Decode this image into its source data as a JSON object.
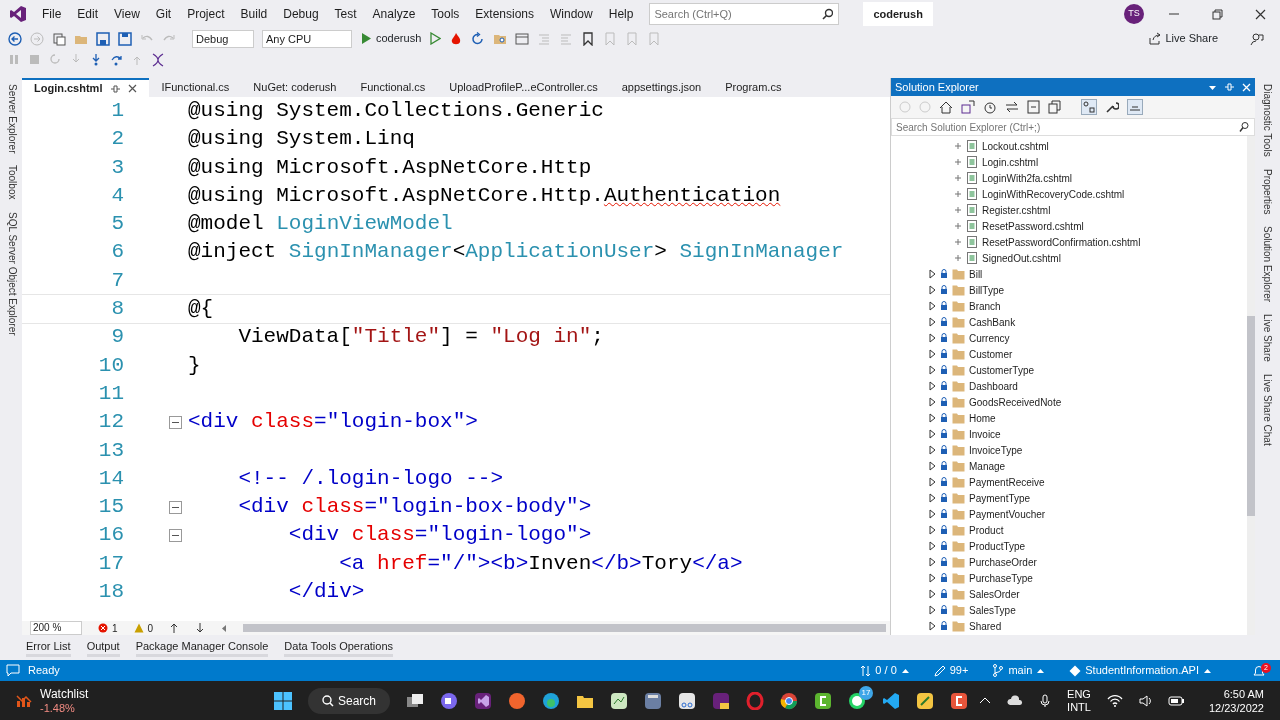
{
  "menu": [
    "File",
    "Edit",
    "View",
    "Git",
    "Project",
    "Build",
    "Debug",
    "Test",
    "Analyze",
    "Tools",
    "Extensions",
    "Window",
    "Help"
  ],
  "search": {
    "placeholder": "Search (Ctrl+Q)"
  },
  "solution_name": "coderush",
  "account_initials": "TS",
  "toolbar": {
    "configuration": "Debug",
    "platform": "Any CPU",
    "start_target": "coderush"
  },
  "live_share": "Live Share",
  "side_tabs_left": [
    "Server Explorer",
    "Toolbox",
    "SQL Server Object Explorer"
  ],
  "doc_tabs": [
    {
      "label": "Login.cshtml",
      "selected": true
    },
    {
      "label": "IFunctional.cs",
      "selected": false
    },
    {
      "label": "NuGet: coderush",
      "selected": false
    },
    {
      "label": "Functional.cs",
      "selected": false
    },
    {
      "label": "UploadProfileP...eController.cs",
      "selected": false
    },
    {
      "label": "appsettings.json",
      "selected": false
    },
    {
      "label": "Program.cs",
      "selected": false
    }
  ],
  "editor": {
    "lines": [
      {
        "number": "1",
        "current": false,
        "fold": false,
        "tokens": [
          {
            "text": "@using System.Collections.Generic",
            "color": "#000000",
            "error": false
          }
        ]
      },
      {
        "number": "2",
        "current": false,
        "fold": false,
        "tokens": [
          {
            "text": "@using System.Linq",
            "color": "#000000",
            "error": false
          }
        ]
      },
      {
        "number": "3",
        "current": false,
        "fold": false,
        "tokens": [
          {
            "text": "@using Microsoft.AspNetCore.Http",
            "color": "#000000",
            "error": false
          }
        ]
      },
      {
        "number": "4",
        "current": false,
        "fold": false,
        "tokens": [
          {
            "text": "@using Microsoft.AspNetCore.Http.",
            "color": "#000000",
            "error": false
          },
          {
            "text": "Authentication",
            "color": "#000000",
            "error": true
          }
        ]
      },
      {
        "number": "5",
        "current": false,
        "fold": false,
        "tokens": [
          {
            "text": "@model ",
            "color": "#000000",
            "error": false
          },
          {
            "text": "LoginViewModel",
            "color": "#2b91af",
            "error": false
          }
        ]
      },
      {
        "number": "6",
        "current": false,
        "fold": false,
        "tokens": [
          {
            "text": "@inject ",
            "color": "#000000",
            "error": false
          },
          {
            "text": "SignInManager",
            "color": "#2b91af",
            "error": false
          },
          {
            "text": "<",
            "color": "#000000",
            "error": false
          },
          {
            "text": "ApplicationUser",
            "color": "#2b91af",
            "error": false
          },
          {
            "text": "> ",
            "color": "#000000",
            "error": false
          },
          {
            "text": "SignInManager",
            "color": "#2b91af",
            "error": false
          }
        ]
      },
      {
        "number": "7",
        "current": false,
        "fold": false
      },
      {
        "number": "8",
        "current": true,
        "fold": false,
        "tokens": [
          {
            "text": "@{",
            "color": "#000000",
            "error": false
          }
        ]
      },
      {
        "number": "9",
        "current": false,
        "fold": false,
        "tokens": [
          {
            "text": "    ViewData[",
            "color": "#000000",
            "error": false
          },
          {
            "text": "\"Title\"",
            "color": "#a31515",
            "error": false
          },
          {
            "text": "] = ",
            "color": "#000000",
            "error": false
          },
          {
            "text": "\"Log in\"",
            "color": "#a31515",
            "error": false
          },
          {
            "text": ";",
            "color": "#000000",
            "error": false
          }
        ]
      },
      {
        "number": "10",
        "current": false,
        "fold": false,
        "tokens": [
          {
            "text": "}",
            "color": "#000000",
            "error": false
          }
        ]
      },
      {
        "number": "11",
        "current": false,
        "fold": false
      },
      {
        "number": "12",
        "current": false,
        "fold": true,
        "tokens": [
          {
            "text": "<div ",
            "color": "#0000c8",
            "error": false
          },
          {
            "text": "class",
            "color": "#e50000",
            "error": false
          },
          {
            "text": "=\"login-box\">",
            "color": "#0000c8",
            "error": false
          }
        ]
      },
      {
        "number": "13",
        "current": false,
        "fold": false
      },
      {
        "number": "14",
        "current": false,
        "fold": false,
        "tokens": [
          {
            "text": "    <!-- /.login-logo -->",
            "color": "#0000c8",
            "error": false
          }
        ]
      },
      {
        "number": "15",
        "current": false,
        "fold": true,
        "tokens": [
          {
            "text": "    <div ",
            "color": "#0000c8",
            "error": false
          },
          {
            "text": "class",
            "color": "#e50000",
            "error": false
          },
          {
            "text": "=\"login-box-body\">",
            "color": "#0000c8",
            "error": false
          }
        ]
      },
      {
        "number": "16",
        "current": false,
        "fold": true,
        "tokens": [
          {
            "text": "        <div ",
            "color": "#0000c8",
            "error": false
          },
          {
            "text": "class",
            "color": "#e50000",
            "error": false
          },
          {
            "text": "=\"login-logo\">",
            "color": "#0000c8",
            "error": false
          }
        ]
      },
      {
        "number": "17",
        "current": false,
        "fold": false,
        "tokens": [
          {
            "text": "            <a ",
            "color": "#0000c8",
            "error": false
          },
          {
            "text": "href",
            "color": "#e50000",
            "error": false
          },
          {
            "text": "=\"/\"><b>",
            "color": "#0000c8",
            "error": false
          },
          {
            "text": "Inven",
            "color": "#000000",
            "error": false
          },
          {
            "text": "</b>",
            "color": "#0000c8",
            "error": false
          },
          {
            "text": "Tory",
            "color": "#000000",
            "error": false
          },
          {
            "text": "</a>",
            "color": "#0000c8",
            "error": false
          }
        ]
      },
      {
        "number": "18",
        "current": false,
        "fold": false,
        "tokens": [
          {
            "text": "        </div>",
            "color": "#0000c8",
            "error": false
          }
        ]
      }
    ],
    "zoom": "200 %",
    "errors": "1",
    "warnings": "0"
  },
  "solution_explorer": {
    "title": "Solution Explorer",
    "search": {
      "placeholder": "Search Solution Explorer (Ctrl+;)"
    },
    "files": [
      "Lockout.cshtml",
      "Login.cshtml",
      "LoginWith2fa.cshtml",
      "LoginWithRecoveryCode.cshtml",
      "Register.cshtml",
      "ResetPassword.cshtml",
      "ResetPasswordConfirmation.cshtml",
      "SignedOut.cshtml"
    ],
    "folders": [
      "Bill",
      "BillType",
      "Branch",
      "CashBank",
      "Currency",
      "Customer",
      "CustomerType",
      "Dashboard",
      "GoodsReceivedNote",
      "Home",
      "Invoice",
      "InvoiceType",
      "Manage",
      "PaymentReceive",
      "PaymentType",
      "PaymentVoucher",
      "Product",
      "ProductType",
      "PurchaseOrder",
      "PurchaseType",
      "SalesOrder",
      "SalesType",
      "Shared"
    ]
  },
  "side_tabs_right": [
    "Diagnostic Tools",
    "Properties",
    "Solution Explorer",
    "Live Share",
    "Live Share Chat"
  ],
  "tool_tabs": [
    "Error List",
    "Output",
    "Package Manager Console",
    "Data Tools Operations"
  ],
  "status_bar": {
    "text": "Ready",
    "line_changes": "0 / 0",
    "pending": "99+",
    "branch": "main",
    "repo": "StudentInformation.API",
    "notifications": "2"
  },
  "taskbar": {
    "widget_title": "Watchlist",
    "widget_value": "-1.48%",
    "search": "Search",
    "chat_badge": "17",
    "language": "ENG",
    "layout": "INTL",
    "time": "6:50 AM",
    "date": "12/23/2022"
  }
}
